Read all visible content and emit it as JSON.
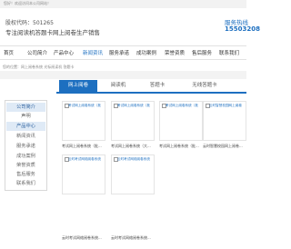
{
  "topbar": {
    "text": "您好！欢迎访问本公司网站！"
  },
  "header": {
    "stock_code": "股权代码：501265",
    "slogan": "专注阅读机答题卡网上阅卷生产销售",
    "hotline_label": "服务热线",
    "hotline_number": "15503208"
  },
  "nav": {
    "items": [
      "首页",
      "公司简介",
      "产品中心",
      "新闻资讯",
      "服务承诺",
      "成功案例",
      "荣誉资质",
      "售后服务",
      "联系我们"
    ]
  },
  "breadcrumb": "您的位置：网上阅卷系统 光标阅读机 答题卡",
  "sidebar": {
    "items": [
      "公司简介",
      "声明",
      "产品中心",
      "新闻资讯",
      "服务承诺",
      "成功案例",
      "荣誉资质",
      "售后服务",
      "联系我们"
    ]
  },
  "tabs": [
    "网上阅卷",
    "阅读机",
    "答题卡",
    "无线答题卡"
  ],
  "products": [
    {
      "alt": "考试网上阅卷系统（批",
      "caption": "考试网上阅卷系统（批..."
    },
    {
      "alt": "考试网上阅卷系统（批",
      "caption": "考试网上阅卷系统（大..."
    },
    {
      "alt": "考试网上阅卷系统（批",
      "caption": "考试网上阅卷系统（批..."
    },
    {
      "alt": "云时智慧校园网上阅卷",
      "caption": "云时智慧校园网上阅卷..."
    },
    {
      "alt": "云时考试网络阅卷系统",
      "caption": "云时考试网络阅卷系统..."
    },
    {
      "alt": "云时考试网络阅卷系统",
      "caption": "云时考试网络阅卷系统..."
    }
  ]
}
